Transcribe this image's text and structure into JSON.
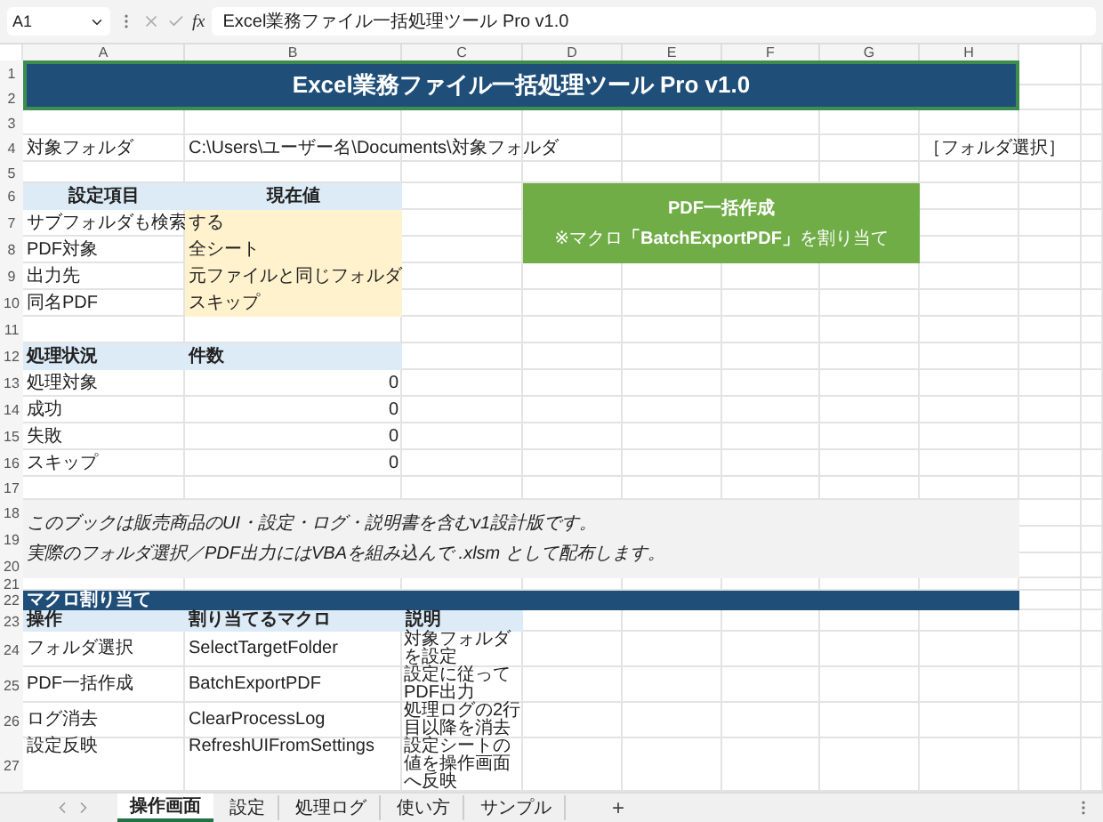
{
  "formula_bar": {
    "cell_ref": "A1",
    "fx": "fx",
    "formula": "Excel業務ファイル一括処理ツール Pro v1.0"
  },
  "columns": [
    "A",
    "B",
    "C",
    "D",
    "E",
    "F",
    "G",
    "H"
  ],
  "rows": [
    "1",
    "2",
    "3",
    "4",
    "5",
    "6",
    "7",
    "8",
    "9",
    "10",
    "11",
    "12",
    "13",
    "14",
    "15",
    "16",
    "17",
    "18",
    "19",
    "20",
    "21",
    "22",
    "23",
    "24",
    "25",
    "26",
    "27"
  ],
  "title": "Excel業務ファイル一括処理ツール Pro v1.0",
  "folder": {
    "label": "対象フォルダ",
    "path": "C:\\Users\\ユーザー名\\Documents\\対象フォルダ",
    "button": "［フォルダ選択］"
  },
  "settings": {
    "headers": [
      "設定項目",
      "現在値"
    ],
    "items": [
      {
        "label": "サブフォルダも検索",
        "value": "する"
      },
      {
        "label": "PDF対象",
        "value": "全シート"
      },
      {
        "label": "出力先",
        "value": "元ファイルと同じフォルダ"
      },
      {
        "label": "同名PDF",
        "value": "スキップ"
      }
    ]
  },
  "macro_button": {
    "title": "PDF一括作成",
    "note": "※マクロ**「BatchExportPDF」**を割り当て"
  },
  "status": {
    "headers": [
      "処理状況",
      "件数"
    ],
    "items": [
      {
        "label": "処理対象",
        "count": "0"
      },
      {
        "label": "成功",
        "count": "0"
      },
      {
        "label": "失敗",
        "count": "0"
      },
      {
        "label": "スキップ",
        "count": "0"
      }
    ]
  },
  "note": [
    "このブックは販売商品のUI・設定・ログ・説明書を含むv1設計版です。",
    "実際のフォルダ選択／PDF出力にはVBAを組み込んで .xlsm として配布します。"
  ],
  "macro_section": {
    "title": "マクロ割り当て",
    "headers": [
      "操作",
      "割り当てるマクロ",
      "説明"
    ],
    "rows": [
      {
        "operation": "フォルダ選択",
        "macro": "SelectTargetFolder",
        "description": "対象フォルダを設定"
      },
      {
        "operation": "PDF一括作成",
        "macro": "BatchExportPDF",
        "description": "設定に従ってPDF出力"
      },
      {
        "operation": "ログ消去",
        "macro": "ClearProcessLog",
        "description": "処理ログの2行目以降を消去"
      },
      {
        "operation": "設定反映",
        "macro": "RefreshUIFromSettings",
        "description": "設定シートの値を操作画面へ反映"
      }
    ]
  },
  "sheet_tabs": [
    {
      "label": "操作画面",
      "selected": true
    },
    {
      "label": "設定",
      "selected": false
    },
    {
      "label": "処理ログ",
      "selected": false
    },
    {
      "label": "使い方",
      "selected": false
    },
    {
      "label": "サンプル",
      "selected": false
    }
  ],
  "add_sheet": "+"
}
